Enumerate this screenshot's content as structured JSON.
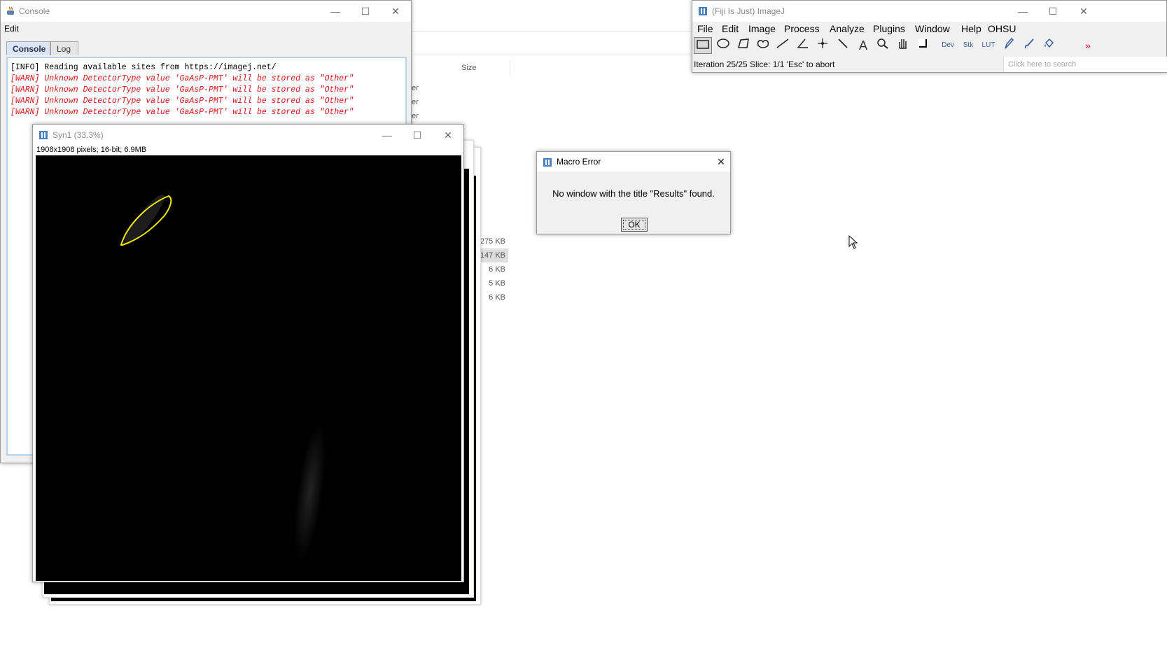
{
  "explorer_bg": {
    "column_size_header": "Size",
    "row_fragments": [
      "er",
      "er",
      "er"
    ],
    "sizes": [
      "275 KB",
      "147 KB",
      "6 KB",
      "5 KB",
      "6 KB"
    ]
  },
  "console": {
    "title": "Console",
    "menu_edit": "Edit",
    "tabs": [
      {
        "label": "Console"
      },
      {
        "label": "Log"
      }
    ],
    "lines": [
      {
        "text": "[INFO] Reading available sites from https://imagej.net/"
      },
      {
        "text": "[WARN] Unknown DetectorType value 'GaAsP-PMT' will be stored as \"Other\""
      },
      {
        "text": "[WARN] Unknown DetectorType value 'GaAsP-PMT' will be stored as \"Other\""
      },
      {
        "text": "[WARN] Unknown DetectorType value 'GaAsP-PMT' will be stored as \"Other\""
      },
      {
        "text": "[WARN] Unknown DetectorType value 'GaAsP-PMT' will be stored as \"Other\""
      }
    ]
  },
  "image_window": {
    "title": "Syn1 (33.3%)",
    "info": "1908x1908 pixels; 16-bit; 6.9MB",
    "roi_color": "#f2e600"
  },
  "imagej": {
    "title": "(Fiji Is Just) ImageJ",
    "menus": [
      "File",
      "Edit",
      "Image",
      "Process",
      "Analyze",
      "Plugins",
      "Window",
      "Help",
      "OHSU"
    ],
    "tools": [
      "rectangle-tool",
      "oval-tool",
      "polygon-tool",
      "freehand-tool",
      "line-tool",
      "angle-tool",
      "point-tool",
      "wand-tool",
      "text-tool",
      "magnifier-tool",
      "hand-tool",
      "color-picker-tool"
    ],
    "special_tools": [
      {
        "name": "Dev"
      },
      {
        "name": "Stk"
      },
      {
        "name": "LUT"
      }
    ],
    "status": "Iteration 25/25  Slice: 1/1 'Esc' to abort",
    "search_placeholder": "Click here to search",
    "accent": "#d6001c"
  },
  "dialog": {
    "title": "Macro Error",
    "message": "No window with the title \"Results\" found.",
    "ok_label": "OK"
  }
}
